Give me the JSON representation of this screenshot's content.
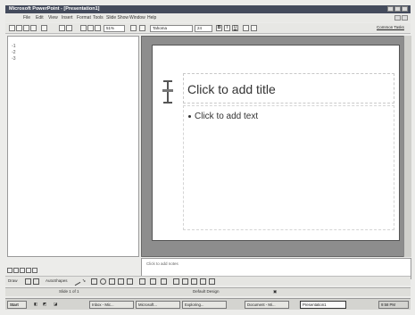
{
  "window": {
    "title": "Microsoft PowerPoint - [Presentation1]"
  },
  "menu": [
    "File",
    "Edit",
    "View",
    "Insert",
    "Format",
    "Tools",
    "Slide Show",
    "Window",
    "Help"
  ],
  "toolbar": {
    "zoom": "51%",
    "font": "Tahoma",
    "font_size": "24",
    "common_tasks": "Common Tasks"
  },
  "slide": {
    "title_placeholder": "Click to add title",
    "body_placeholder": "Click to add text"
  },
  "notes": {
    "placeholder": "Click to add notes"
  },
  "drawing": {
    "draw_label": "Draw",
    "autoshapes_label": "AutoShapes"
  },
  "status": {
    "slide": "Slide 1 of 1",
    "design": "Default Design"
  },
  "taskbar": {
    "start": "Start",
    "tasks": [
      "Inbox - Mic...",
      "Microsoft...",
      "Exploring...",
      "Document - Mi...",
      "Presentation1"
    ],
    "clock": "9:58 PM"
  },
  "icons": {
    "bold": "B",
    "italic": "I",
    "underline": "U"
  }
}
